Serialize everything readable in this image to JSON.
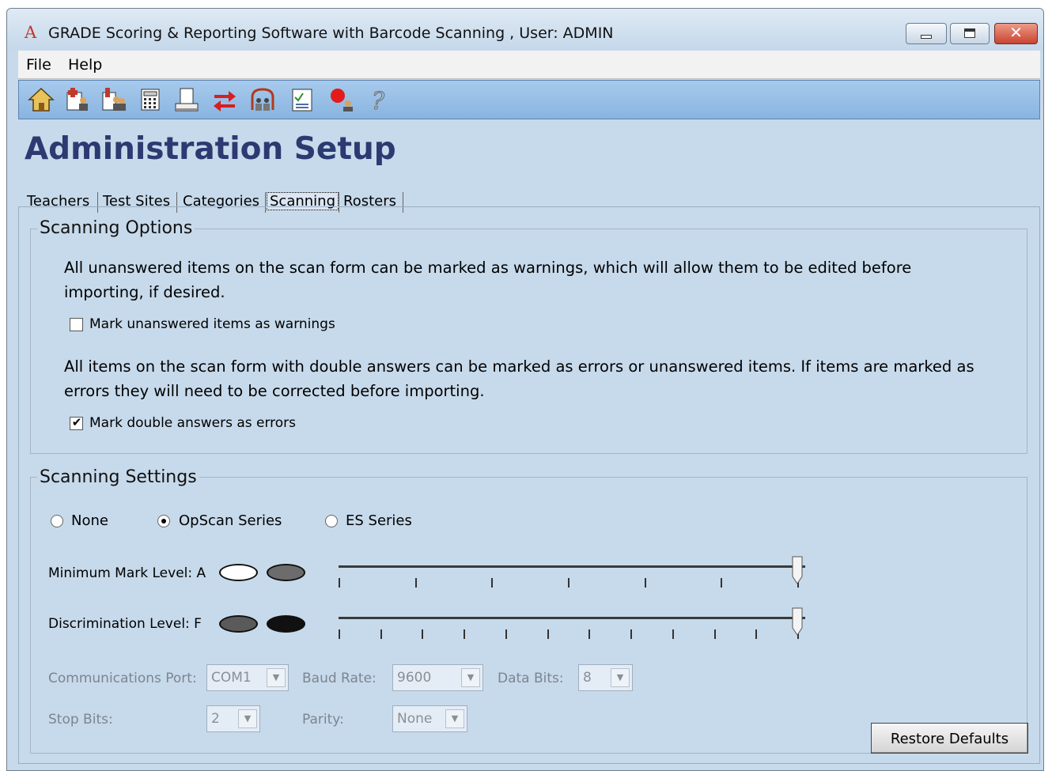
{
  "window": {
    "title": "GRADE Scoring & Reporting Software with Barcode Scanning , User: ADMIN",
    "app_icon": "A",
    "close_glyph": "✕"
  },
  "menu": {
    "items": [
      "File",
      "Help"
    ]
  },
  "toolbar": {
    "icons": [
      "home-icon",
      "add-student-icon",
      "add-group-icon",
      "calculator-icon",
      "print-icon",
      "transfer-icon",
      "users-icon",
      "report-icon",
      "scanner-icon",
      "help-icon"
    ],
    "glyphs": [
      "🏠",
      "📄",
      "👥",
      "🖩",
      "🖶",
      "⇄",
      "☊",
      "📊",
      "⬤",
      "?"
    ]
  },
  "page": {
    "title": "Administration Setup"
  },
  "tabs": {
    "items": [
      "Teachers",
      "Test Sites",
      "Categories",
      "Scanning",
      "Rosters"
    ],
    "active": "Scanning"
  },
  "options": {
    "title": "Scanning Options",
    "para1_line1": "All unanswered items on the scan form can be marked as warnings, which will allow them to be edited before",
    "para1_line2": "importing, if desired.",
    "checkbox1_label": "Mark unanswered items as warnings",
    "checkbox1_checked": false,
    "para2_line1": "All items on the scan form with double answers can be marked as errors or unanswered items. If items are marked as",
    "para2_line2": "errors they will need to be corrected before importing.",
    "checkbox2_label": "Mark double answers as errors",
    "checkbox2_checked": true,
    "check_glyph": "✔"
  },
  "settings": {
    "title": "Scanning Settings",
    "radios": [
      "None",
      "OpScan Series",
      "ES Series"
    ],
    "selected_radio": "OpScan Series",
    "min_mark_label": "Minimum Mark Level: A",
    "discrimination_label": "Discrimination Level: F",
    "min_mark_ticks": 7,
    "discrimination_ticks": 12,
    "min_mark_position": 1.0,
    "discrimination_position": 1.0,
    "comm_port_label": "Communications Port:",
    "comm_port_value": "COM1",
    "baud_rate_label": "Baud Rate:",
    "baud_rate_value": "9600",
    "data_bits_label": "Data Bits:",
    "data_bits_value": "8",
    "stop_bits_label": "Stop Bits:",
    "stop_bits_value": "2",
    "parity_label": "Parity:",
    "parity_value": "None",
    "restore_label": "Restore Defaults",
    "dropdown_glyph": "▼"
  },
  "colors": {
    "title_blue": "#2b3a71",
    "window_bg": "#c7daeb",
    "toolbar_blue": "#9cc1e8",
    "disabled_text": "#7c8590"
  }
}
